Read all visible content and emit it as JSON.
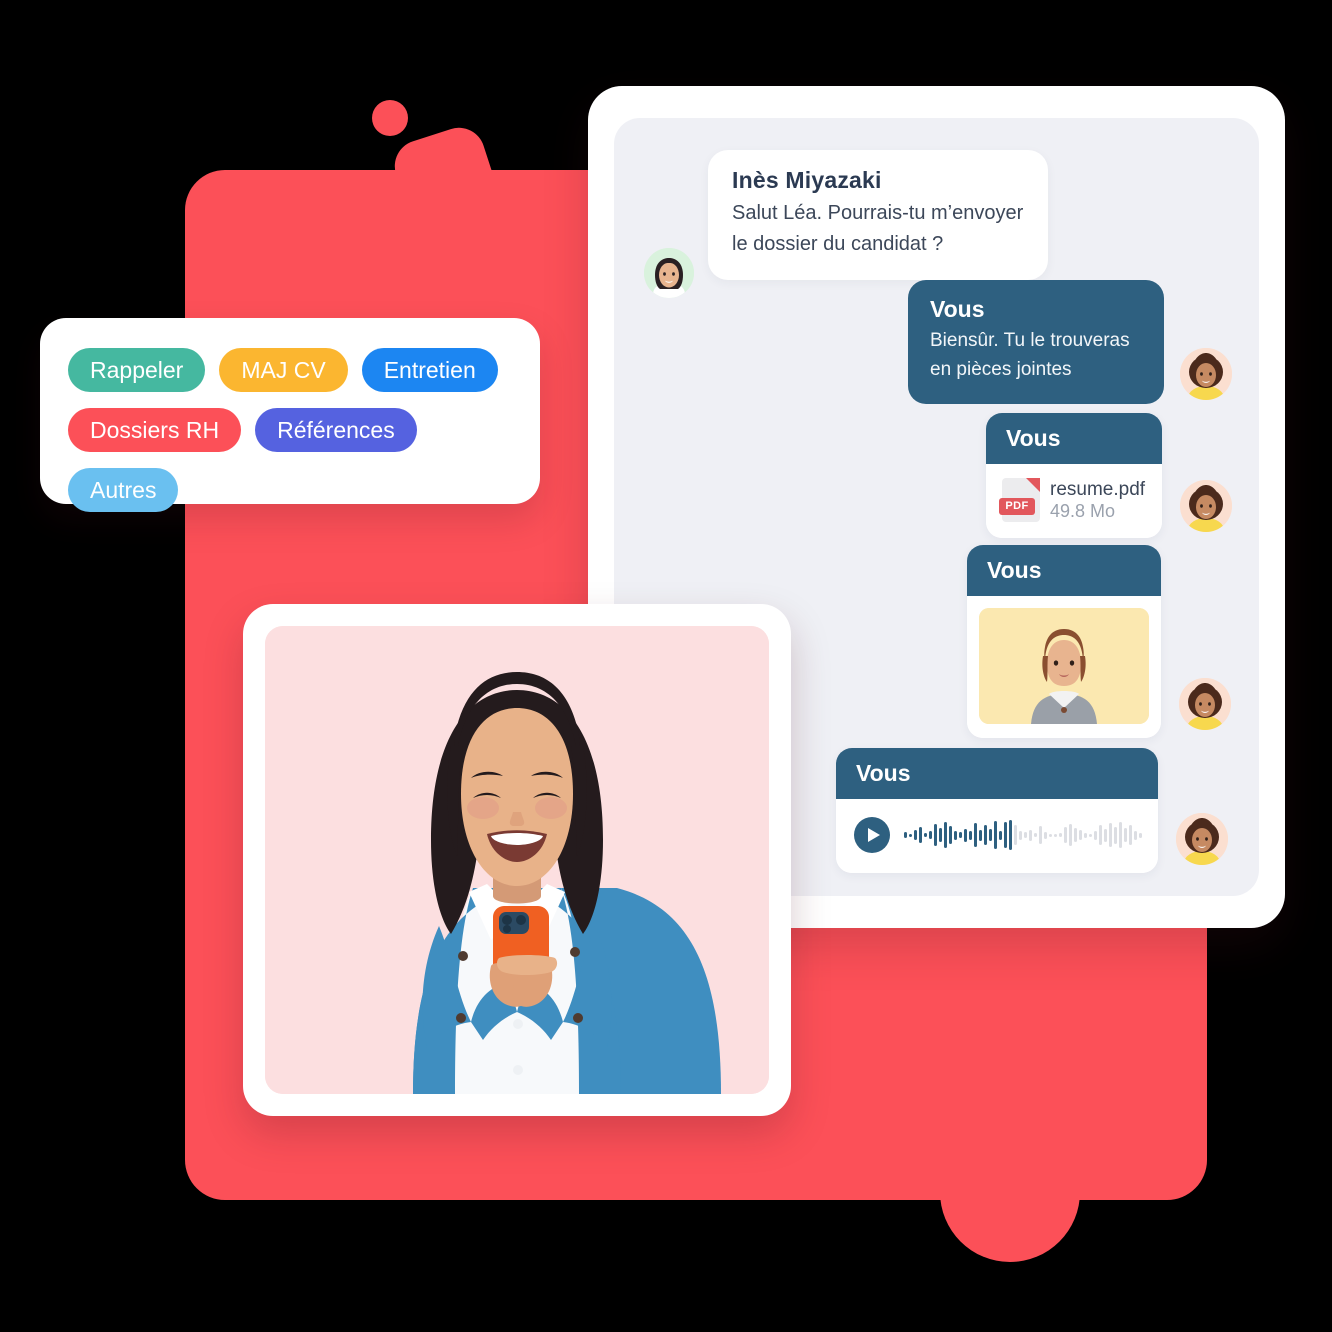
{
  "theme": {
    "accent_red": "#fc5058",
    "bubble_dark": "#2e6080",
    "chat_panel_bg": "#eff0f5",
    "photo_bg": "#fcdfe0",
    "thumb_bg": "#fbe8b0"
  },
  "chat": {
    "messages": [
      {
        "sender": "Inès Miyazaki",
        "text": "Salut Léa. Pourrais-tu m’envoyer le dossier du candidat ?",
        "type": "text-incoming",
        "avatar": "avatar-ines"
      },
      {
        "sender": "Vous",
        "text": "Biensûr. Tu le trouveras en pièces jointes",
        "type": "text-outgoing",
        "avatar": "avatar-vous"
      },
      {
        "sender": "Vous",
        "type": "file-attachment",
        "file_name": "resume.pdf",
        "file_size": "49.8 Mo",
        "file_badge": "PDF",
        "avatar": "avatar-vous"
      },
      {
        "sender": "Vous",
        "type": "image-attachment",
        "avatar": "avatar-vous"
      },
      {
        "sender": "Vous",
        "type": "voice-attachment",
        "avatar": "avatar-vous"
      }
    ]
  },
  "tags": {
    "chips": [
      {
        "label": "Rappeler",
        "color": "#45b8a0"
      },
      {
        "label": "MAJ CV",
        "color": "#fbb630"
      },
      {
        "label": "Entretien",
        "color": "#1c86f2"
      },
      {
        "label": "Dossiers RH",
        "color": "#fc5058"
      },
      {
        "label": "Références",
        "color": "#5562e0"
      },
      {
        "label": "Autres",
        "color": "#6ac0f0"
      }
    ]
  },
  "waveform": {
    "played": [
      6,
      3,
      10,
      16,
      4,
      8,
      22,
      14,
      26,
      18,
      9,
      6,
      13,
      9,
      24,
      11,
      20,
      12,
      28,
      9,
      26,
      30
    ],
    "unplayed": [
      20,
      9,
      6,
      11,
      4,
      18,
      7,
      3,
      3,
      4,
      16,
      22,
      14,
      10,
      5,
      3,
      9,
      20,
      13,
      24,
      17,
      26,
      14,
      20,
      9,
      5
    ]
  }
}
